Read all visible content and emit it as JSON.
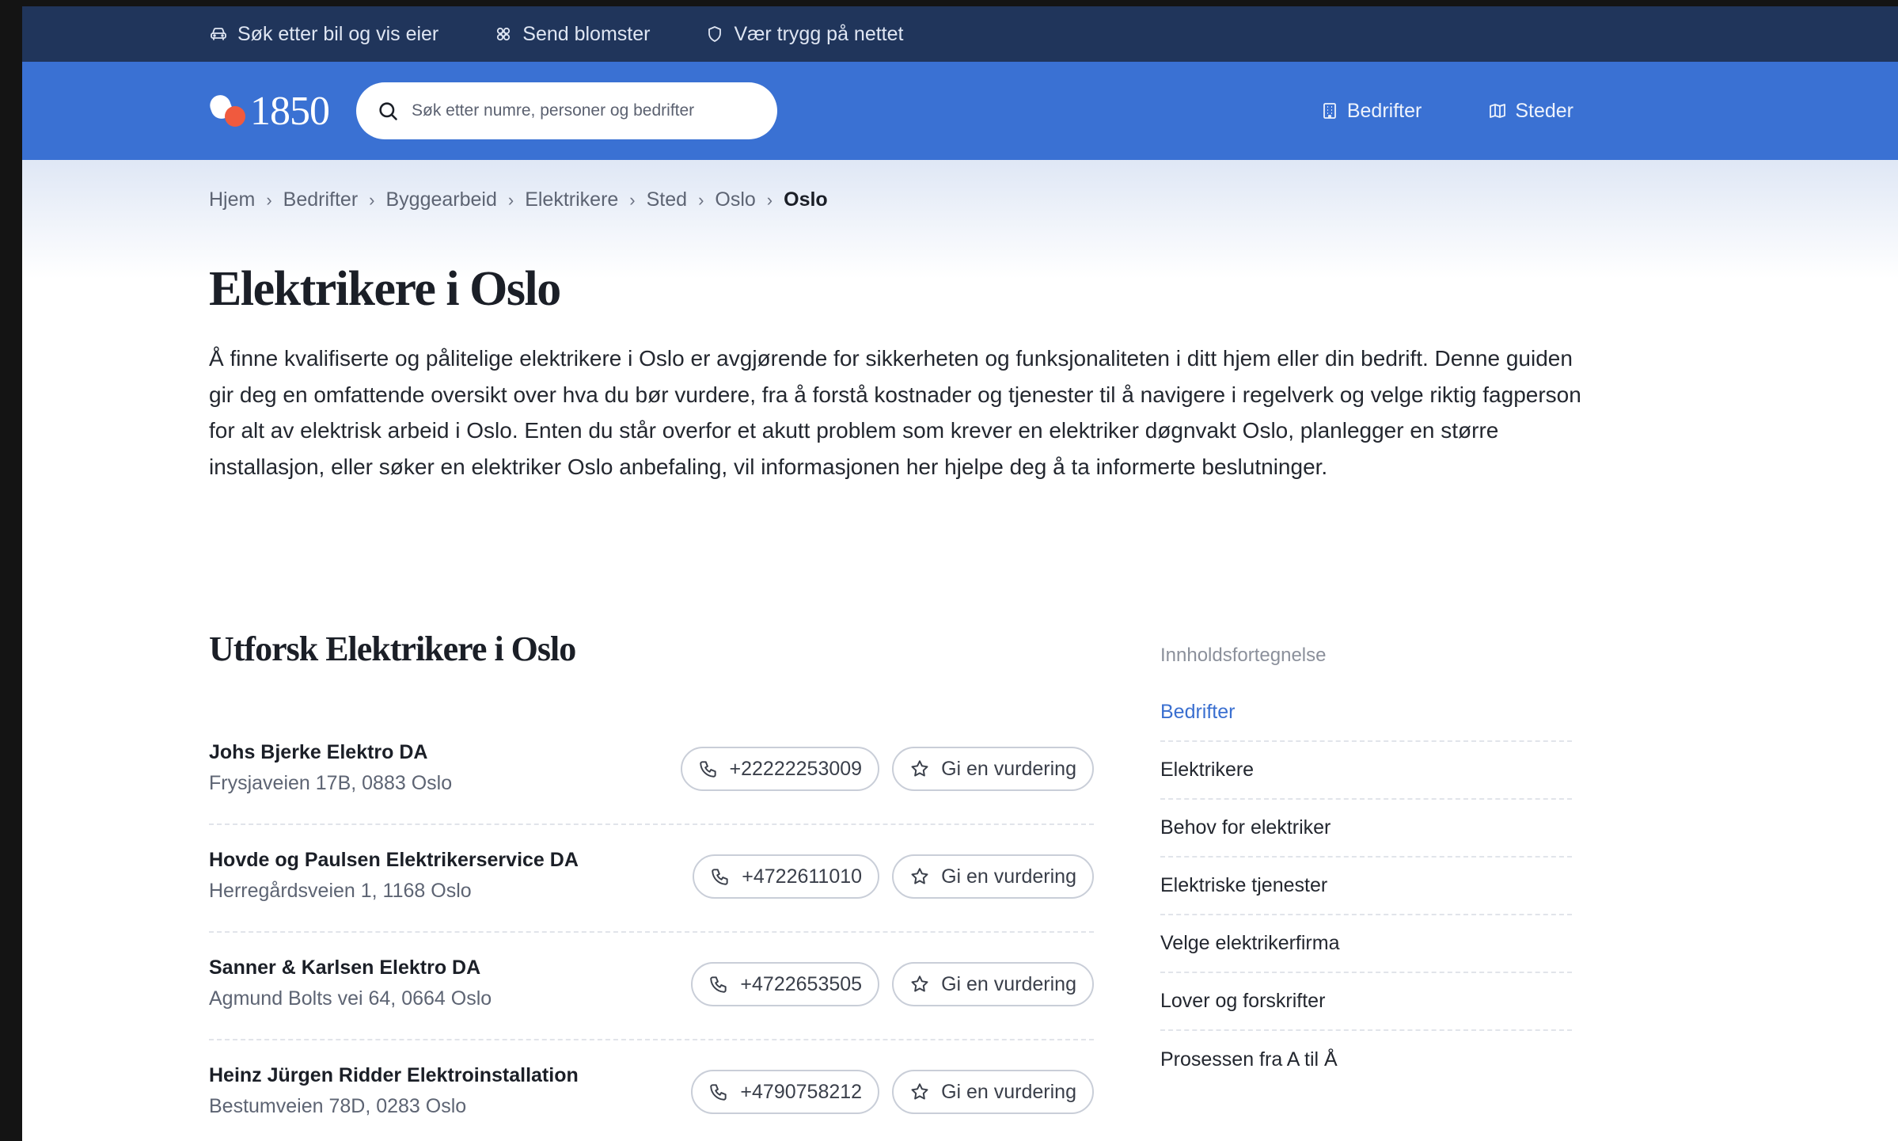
{
  "utility_bar": {
    "items": [
      {
        "label": "Søk etter bil og vis eier",
        "icon": "car-icon"
      },
      {
        "label": "Send blomster",
        "icon": "flower-icon"
      },
      {
        "label": "Vær trygg på nettet",
        "icon": "shield-icon"
      }
    ]
  },
  "header": {
    "logo_text": "1850",
    "search_placeholder": "Søk etter numre, personer og bedrifter",
    "nav": [
      {
        "label": "Bedrifter",
        "icon": "building-icon"
      },
      {
        "label": "Steder",
        "icon": "map-icon"
      }
    ]
  },
  "breadcrumb": [
    "Hjem",
    "Bedrifter",
    "Byggearbeid",
    "Elektrikere",
    "Sted",
    "Oslo",
    "Oslo"
  ],
  "page": {
    "title": "Elektrikere i Oslo",
    "intro": "Å finne kvalifiserte og pålitelige elektrikere i Oslo er avgjørende for sikkerheten og funksjonaliteten i ditt hjem eller din bedrift. Denne guiden gir deg en omfattende oversikt over hva du bør vurdere, fra å forstå kostnader og tjenester til å navigere i regelverk og velge riktig fagperson for alt av elektrisk arbeid i Oslo. Enten du står overfor et akutt problem som krever en elektriker døgnvakt Oslo, planlegger en større installasjon, eller søker en elektriker Oslo anbefaling, vil informasjonen her hjelpe deg å ta informerte beslutninger.",
    "section_title": "Utforsk Elektrikere i Oslo"
  },
  "listings": [
    {
      "name": "Johs Bjerke Elektro DA",
      "address": "Frysjaveien 17B, 0883 Oslo",
      "phone": "+22222253009",
      "review_label": "Gi en vurdering"
    },
    {
      "name": "Hovde og Paulsen Elektrikerservice DA",
      "address": "Herregårdsveien 1, 1168 Oslo",
      "phone": "+4722611010",
      "review_label": "Gi en vurdering"
    },
    {
      "name": "Sanner & Karlsen Elektro DA",
      "address": "Agmund Bolts vei 64, 0664 Oslo",
      "phone": "+4722653505",
      "review_label": "Gi en vurdering"
    },
    {
      "name": "Heinz Jürgen Ridder Elektroinstallation",
      "address": "Bestumveien 78D, 0283 Oslo",
      "phone": "+4790758212",
      "review_label": "Gi en vurdering"
    }
  ],
  "toc": {
    "heading": "Innholdsfortegnelse",
    "items": [
      "Bedrifter",
      "Elektrikere",
      "Behov for elektriker",
      "Elektriske tjenester",
      "Velge elektrikerfirma",
      "Lover og forskrifter",
      "Prosessen fra A til Å"
    ]
  },
  "colors": {
    "utility_bar": "#20355b",
    "header": "#3a71d3",
    "logo_dot": "#f05a3e",
    "toc_active": "#3a6fd0"
  }
}
